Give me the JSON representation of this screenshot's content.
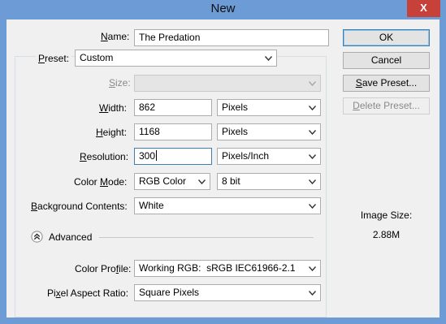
{
  "window": {
    "title": "New",
    "close_glyph": "X"
  },
  "name": {
    "label": "Name:",
    "value": "The Predation"
  },
  "preset": {
    "label": "Preset:",
    "value": "Custom"
  },
  "size": {
    "label": "Size:",
    "value": ""
  },
  "width": {
    "label": "Width:",
    "value": "862",
    "unit": "Pixels"
  },
  "height": {
    "label": "Height:",
    "value": "1168",
    "unit": "Pixels"
  },
  "resolution": {
    "label": "Resolution:",
    "value": "300",
    "unit": "Pixels/Inch"
  },
  "color_mode": {
    "label": "Color Mode:",
    "value": "RGB Color",
    "depth": "8 bit"
  },
  "background": {
    "label": "Background Contents:",
    "value": "White"
  },
  "advanced": {
    "label": "Advanced",
    "expanded": true
  },
  "color_profile": {
    "label": "Color Profile:",
    "value": "Working RGB:  sRGB IEC61966-2.1"
  },
  "pixel_aspect": {
    "label": "Pixel Aspect Ratio:",
    "value": "Square Pixels"
  },
  "buttons": {
    "ok": "OK",
    "cancel": "Cancel",
    "save_preset": "Save Preset...",
    "delete_preset": "Delete Preset..."
  },
  "image_size": {
    "label": "Image Size:",
    "value": "2.88M"
  },
  "icons": {
    "close": "close-icon",
    "dropdown": "chevron-down-icon",
    "advanced_toggle": "chevron-up-circle-icon"
  }
}
